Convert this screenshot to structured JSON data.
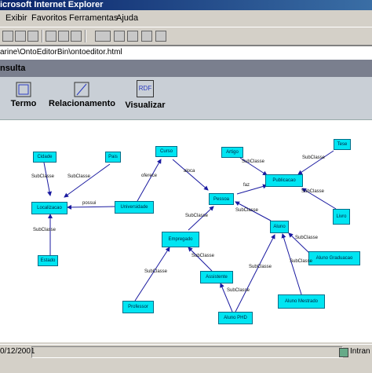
{
  "window": {
    "title": "icrosoft Internet Explorer"
  },
  "menu": {
    "items": [
      "Exibir",
      "Favoritos",
      "Ferramentas",
      "Ajuda"
    ]
  },
  "address": {
    "value": "arine\\OntoEditorBin\\ontoeditor.html"
  },
  "panel": {
    "header": "nsulta"
  },
  "palette": {
    "termo": "Termo",
    "relacionamento": "Relacionamento",
    "visualizar": "Visualizar",
    "rdf": "RDF"
  },
  "nodes": {
    "cidade": "Cidade",
    "pais": "Pais",
    "curso": "Curso",
    "artigo": "Artigo",
    "tese": "Tese",
    "publicacao": "Publicacao",
    "localizacao": "Localizacao",
    "universidade": "Universidade",
    "pessoa": "Pessoa",
    "livro": "Livro",
    "aluno": "Aluno",
    "empregado": "Empregado",
    "estado": "Estado",
    "aluno_graduacao": "Aluno Graduacao",
    "assistente": "Assistente",
    "professor": "Professor",
    "aluno_mestrado": "Aluno Mestrado",
    "aluno_phd": "Aluno PHD"
  },
  "edges": {
    "subclasse": "SubClasse",
    "possui": "possui",
    "oferece": "oferece",
    "aloca": "aloca",
    "faz": "faz"
  },
  "status": {
    "date": "0/12/2001",
    "zone": "Intran"
  }
}
